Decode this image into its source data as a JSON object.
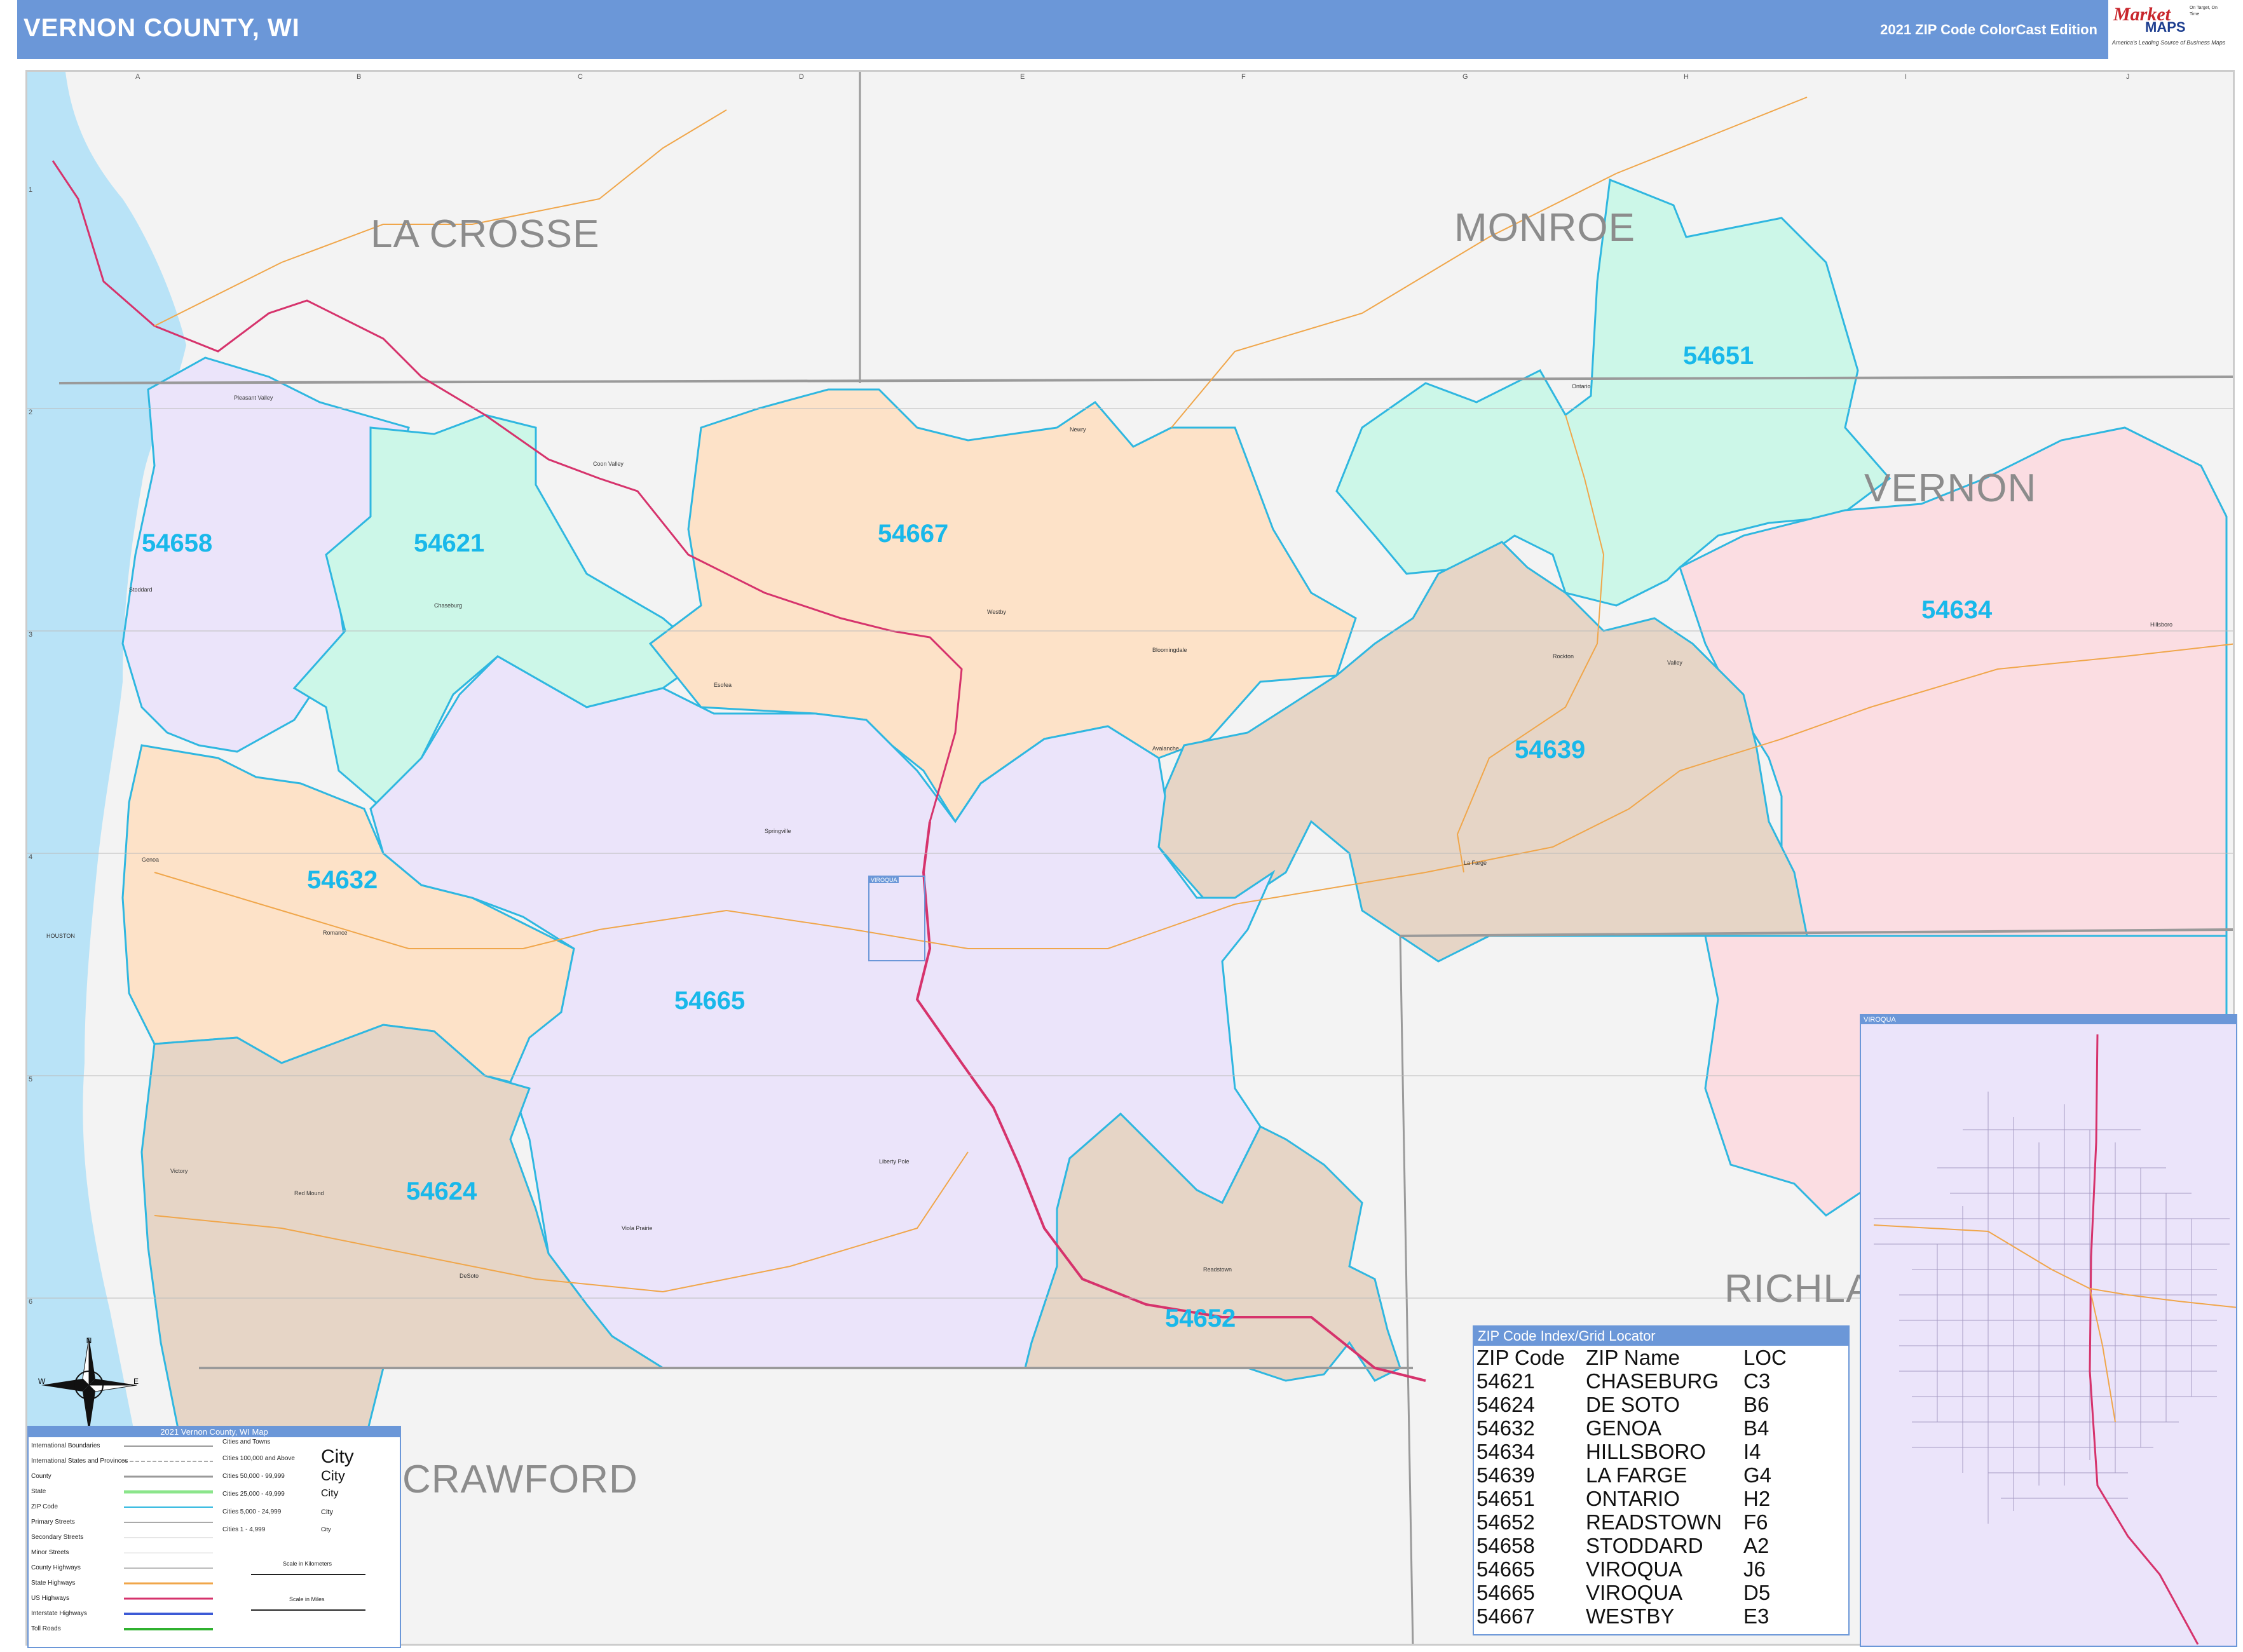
{
  "header": {
    "title": "VERNON COUNTY, WI",
    "edition": "2021 ZIP Code ColorCast Edition"
  },
  "logo": {
    "name_part1": "Market",
    "name_part2": "MAPS",
    "tagline": "America's Leading Source of Business Maps",
    "slogan": "On Target, On Time"
  },
  "grid": {
    "columns": [
      "A",
      "B",
      "C",
      "D",
      "E",
      "F",
      "G",
      "H",
      "I",
      "J"
    ],
    "rows": [
      "1",
      "2",
      "3",
      "4",
      "5",
      "6"
    ]
  },
  "counties": {
    "la_crosse": "LA CROSSE",
    "monroe": "MONROE",
    "vernon": "VERNON",
    "crawford": "CRAWFORD",
    "richland": "RICHLA"
  },
  "zip_labels": {
    "z54658": "54658",
    "z54621": "54621",
    "z54667": "54667",
    "z54651": "54651",
    "z54634": "54634",
    "z54639": "54639",
    "z54632": "54632",
    "z54665": "54665",
    "z54624": "54624",
    "z54652": "54652"
  },
  "zip_colors": {
    "54658": "#ebe4fa",
    "54621": "#ccf7e8",
    "54667": "#fde2c8",
    "54651": "#ccf7e8",
    "54634": "#fbdde2",
    "54639": "#e6d5c6",
    "54632": "#fde2c8",
    "54665": "#ebe4fa",
    "54624": "#e6d5c6",
    "54652": "#e6d5c6",
    "boundary": "#2fb7e0",
    "water": "#b9e3f7",
    "us_highway": "#d6336c",
    "state_highway": "#f0a64a"
  },
  "towns": {
    "pleasant_valley": "Pleasant Valley",
    "coon_valley": "Coon Valley",
    "newry": "Newry",
    "ontario": "Ontario",
    "stoddard": "Stoddard",
    "chaseburg": "Chaseburg",
    "westby": "Westby",
    "bloomingdale": "Bloomingdale",
    "esofea": "Esofea",
    "rockton": "Rockton",
    "valley": "Valley",
    "hillsboro": "Hillsboro",
    "avalanche": "Avalanche",
    "springville": "Springville",
    "genoa": "Genoa",
    "romance": "Romance",
    "la_farge": "La Farge",
    "viroqua": "VIROQUA",
    "liberty_pole": "Liberty Pole",
    "victory": "Victory",
    "red_mound": "Red Mound",
    "viola_prairie": "Viola Prairie",
    "readstown": "Readstown",
    "de_soto": "DeSoto",
    "houston": "HOUSTON"
  },
  "zip_index": {
    "title": "ZIP Code Index/Grid Locator",
    "headers": [
      "ZIP Code",
      "ZIP Name",
      "LOC"
    ],
    "rows": [
      [
        "54621",
        "CHASEBURG",
        "C3"
      ],
      [
        "54624",
        "DE SOTO",
        "B6"
      ],
      [
        "54632",
        "GENOA",
        "B4"
      ],
      [
        "54634",
        "HILLSBORO",
        "I4"
      ],
      [
        "54639",
        "LA FARGE",
        "G4"
      ],
      [
        "54651",
        "ONTARIO",
        "H2"
      ],
      [
        "54652",
        "READSTOWN",
        "F6"
      ],
      [
        "54658",
        "STODDARD",
        "A2"
      ],
      [
        "54665",
        "VIROQUA",
        "J6"
      ],
      [
        "54665",
        "VIROQUA",
        "D5"
      ],
      [
        "54667",
        "WESTBY",
        "E3"
      ]
    ]
  },
  "legend": {
    "title": "2021 Vernon County, WI Map",
    "items": [
      "International Boundaries",
      "International States and Provinces",
      "County",
      "State",
      "ZIP Code",
      "Primary Streets",
      "Secondary Streets",
      "Minor Streets",
      "County Highways",
      "State Highways",
      "US Highways",
      "Interstate Highways",
      "Toll Roads"
    ],
    "city_header": "Cities and Towns",
    "city_items": [
      "Cities 100,000 and Above",
      "Cities 50,000 - 99,999",
      "Cities 25,000 - 49,999",
      "Cities 5,000 - 24,999",
      "Cities 1 - 4,999"
    ],
    "city_samples": [
      "City",
      "City",
      "City",
      "City",
      "City"
    ],
    "scale_km": "Scale in Kilometers",
    "scale_mi": "Scale in Miles"
  },
  "inset": {
    "title": "VIROQUA"
  },
  "compass": {
    "n": "N",
    "s": "S",
    "e": "E",
    "w": "W"
  }
}
